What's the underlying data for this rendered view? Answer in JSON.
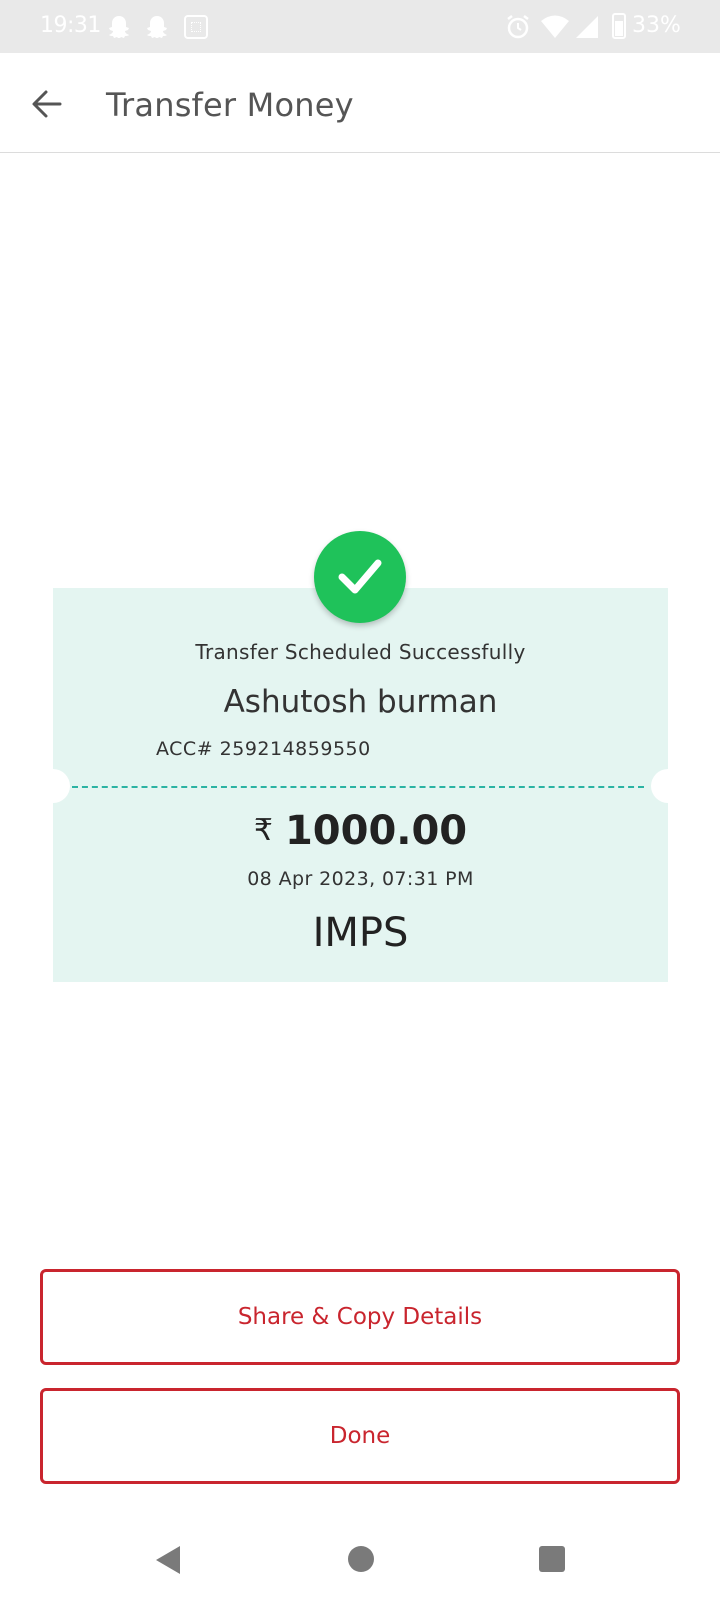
{
  "status_bar": {
    "time": "19:31",
    "battery": "33%",
    "icons": [
      "snapchat-icon",
      "snapchat-icon",
      "message-icon",
      "alarm-icon",
      "wifi-icon",
      "signal-icon",
      "battery-icon"
    ]
  },
  "app_bar": {
    "title": "Transfer Money",
    "back_icon": "arrow-left-icon"
  },
  "receipt": {
    "status_icon": "check-icon",
    "status_text": "Transfer Scheduled Successfully",
    "payee_name": "Ashutosh burman",
    "account": "ACC# 259214859550",
    "currency_symbol": "₹",
    "amount": "1000.00",
    "datetime": "08 Apr 2023, 07:31 PM",
    "mode": "IMPS"
  },
  "actions": {
    "share_label": "Share & Copy Details",
    "done_label": "Done"
  },
  "colors": {
    "accent_red": "#c9252e",
    "success_green": "#1fc25a",
    "receipt_bg": "#e4f5f1",
    "dash_teal": "#2bb3a3"
  },
  "nav_bar": {
    "icons": [
      "back-triangle-icon",
      "home-circle-icon",
      "recents-square-icon"
    ]
  }
}
